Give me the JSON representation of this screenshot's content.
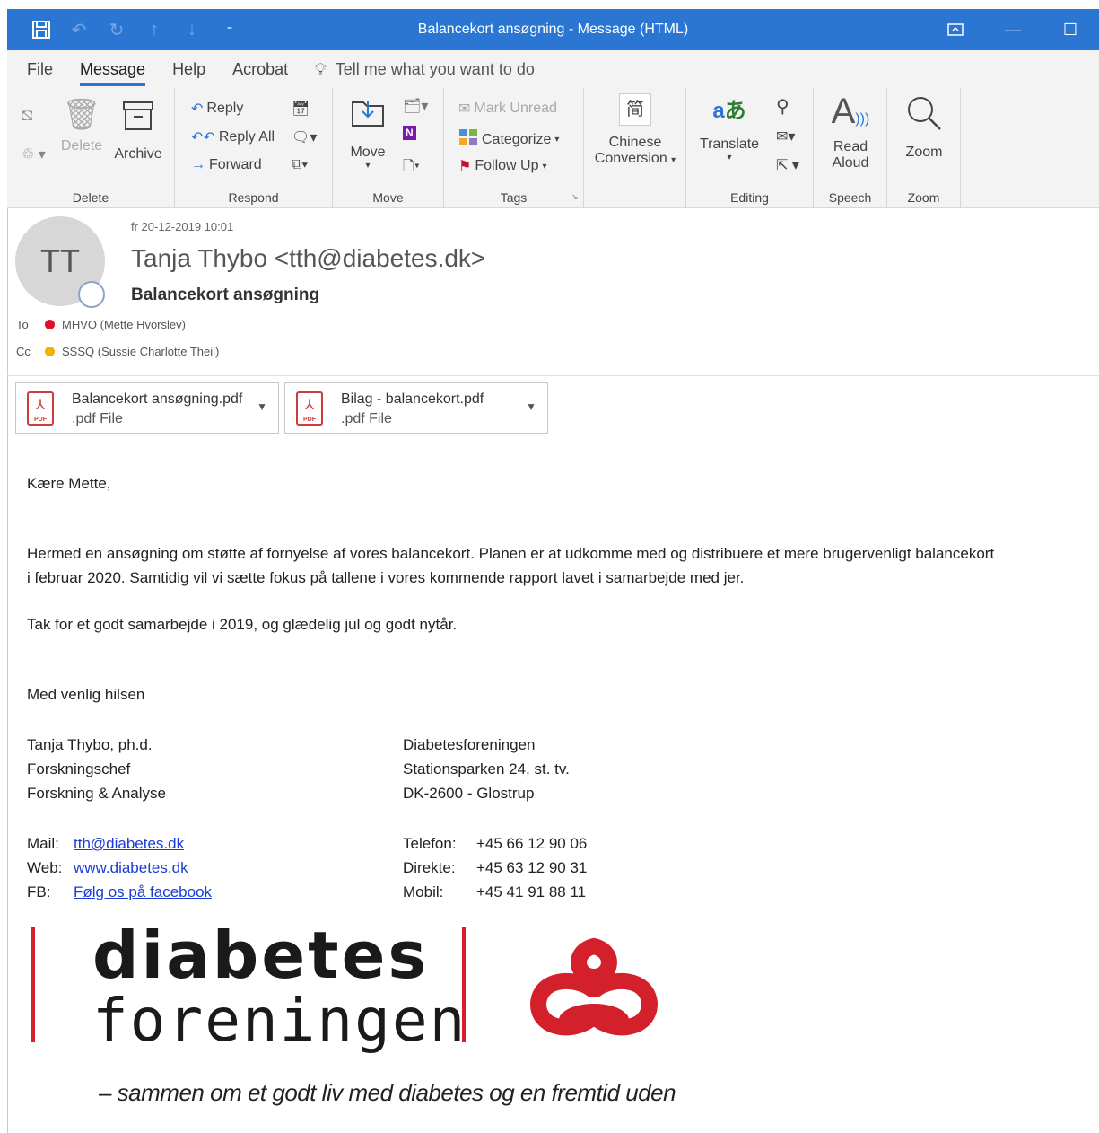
{
  "window": {
    "title": "Balancekort ansøgning  -  Message (HTML)",
    "qat_icons": [
      "save-icon",
      "undo-icon",
      "redo-icon",
      "up-arrow-icon",
      "down-arrow-icon",
      "customize-icon"
    ]
  },
  "menu": {
    "tabs": [
      "File",
      "Message",
      "Help",
      "Acrobat"
    ],
    "active_tab": "Message",
    "tell_me": "Tell me what you want to do"
  },
  "ribbon": {
    "delete": {
      "group": "Delete",
      "delete_label": "Delete",
      "archive_label": "Archive"
    },
    "respond": {
      "group": "Respond",
      "reply": "Reply",
      "reply_all": "Reply All",
      "forward": "Forward"
    },
    "move": {
      "group": "Move",
      "move_label": "Move"
    },
    "tags": {
      "group": "Tags",
      "mark_unread": "Mark Unread",
      "categorize": "Categorize",
      "follow_up": "Follow Up"
    },
    "chinese": {
      "line1": "Chinese",
      "line2": "Conversion"
    },
    "editing": {
      "group": "Editing",
      "translate": "Translate"
    },
    "speech": {
      "group": "Speech",
      "line1": "Read",
      "line2": "Aloud"
    },
    "zoom": {
      "group": "Zoom",
      "label": "Zoom"
    }
  },
  "message": {
    "avatar_initials": "TT",
    "date": "fr 20-12-2019 10:01",
    "sender": "Tanja Thybo <tth@diabetes.dk>",
    "subject": "Balancekort ansøgning",
    "to_label": "To",
    "to_value": "MHVO (Mette Hvorslev)",
    "cc_label": "Cc",
    "cc_value": "SSSQ (Sussie Charlotte Theil)",
    "colors": {
      "to_dot": "#e0102a",
      "cc_dot": "#f0b400"
    }
  },
  "attachments": [
    {
      "name": "Balancekort ansøgning.pdf",
      "type": ".pdf File"
    },
    {
      "name": "Bilag - balancekort.pdf",
      "type": ".pdf File"
    }
  ],
  "body": {
    "greeting": "Kære Mette,",
    "para1_line1": "Hermed en ansøgning om støtte af fornyelse af vores balancekort. Planen er at udkomme med og distribuere et mere brugervenligt balancekort",
    "para1_line2": "i februar 2020. Samtidig vil vi sætte fokus på tallene i vores kommende rapport lavet i samarbejde med jer.",
    "para2": "Tak for et godt samarbejde i 2019, og glædelig jul og godt nytår.",
    "closing": "Med venlig hilsen"
  },
  "signature": {
    "name": "Tanja Thybo, ph.d.",
    "role": "Forskningschef",
    "dept": "Forskning & Analyse",
    "org": "Diabetesforeningen",
    "street": "Stationsparken 24, st. tv.",
    "city": "DK-2600 - Glostrup",
    "mail_label": "Mail:",
    "mail_value": "tth@diabetes.dk",
    "web_label": "Web:",
    "web_value": "www.diabetes.dk",
    "fb_label": "FB:",
    "fb_value": "Følg os på facebook",
    "tel_label": "Telefon:",
    "tel_value": "+45 66 12 90 06",
    "direct_label": "Direkte:",
    "direct_value": "+45 63 12 90 31",
    "mobile_label": "Mobil:",
    "mobile_value": "+45 41 91 88 11"
  },
  "logo": {
    "word1": "diabetes",
    "word2": "foreningen",
    "tagline": "– sammen om et godt liv med diabetes og en fremtid uden",
    "brand_red": "#d4202b"
  }
}
